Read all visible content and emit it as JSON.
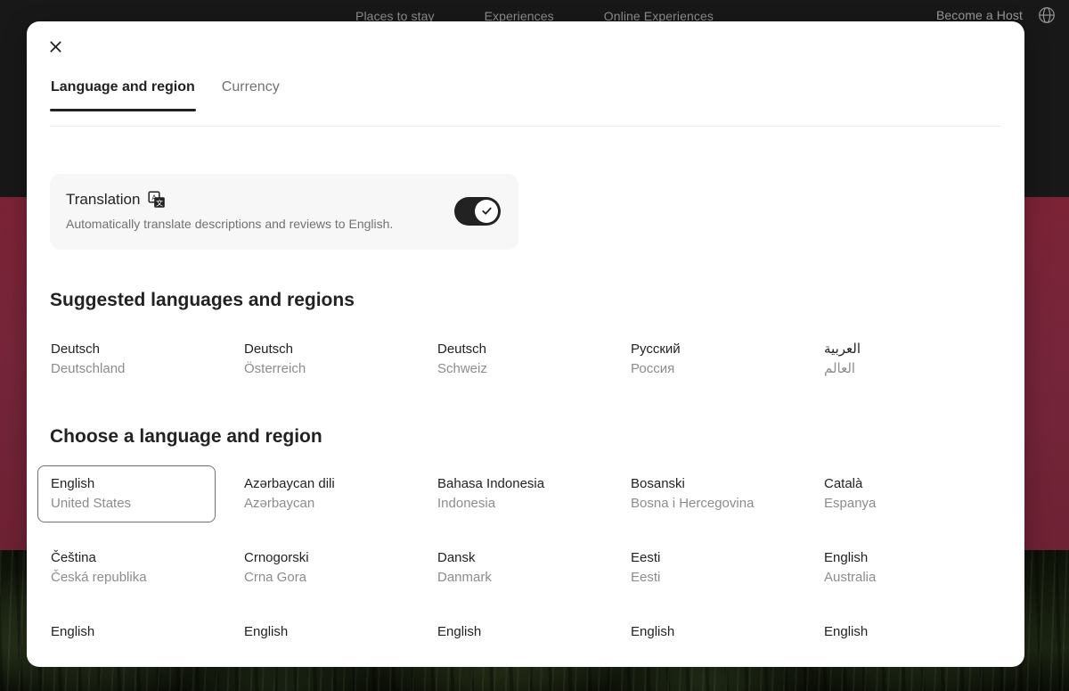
{
  "site": {
    "nav_links": [
      "Places to stay",
      "Experiences",
      "Online Experiences"
    ],
    "become_host": "Become a Host",
    "globe_icon": "globe-icon",
    "header_bg": "#181818",
    "hero_band_color": "#7c2336"
  },
  "modal": {
    "close_icon": "close-icon",
    "tabs": [
      {
        "label": "Language and region",
        "active": true
      },
      {
        "label": "Currency",
        "active": false
      }
    ],
    "translation": {
      "title": "Translation",
      "icon": "translate-icon",
      "description": "Automatically translate descriptions and reviews to English.",
      "enabled": true,
      "toggle_icon": "check-icon",
      "toggle_on_color": "#222222"
    },
    "suggested": {
      "heading": "Suggested languages and regions",
      "items": [
        {
          "name": "Deutsch",
          "region": "Deutschland",
          "rtl": false
        },
        {
          "name": "Deutsch",
          "region": "Österreich",
          "rtl": false
        },
        {
          "name": "Deutsch",
          "region": "Schweiz",
          "rtl": false
        },
        {
          "name": "Русский",
          "region": "Россия",
          "rtl": false
        },
        {
          "name": "العربية",
          "region": "العالم",
          "rtl": true
        }
      ]
    },
    "choose": {
      "heading": "Choose a language and region",
      "items": [
        {
          "name": "English",
          "region": "United States",
          "selected": true
        },
        {
          "name": "Azərbaycan dili",
          "region": "Azərbaycan",
          "selected": false
        },
        {
          "name": "Bahasa Indonesia",
          "region": "Indonesia",
          "selected": false
        },
        {
          "name": "Bosanski",
          "region": "Bosna i Hercegovina",
          "selected": false
        },
        {
          "name": "Català",
          "region": "Espanya",
          "selected": false
        },
        {
          "name": "Čeština",
          "region": "Česká republika",
          "selected": false
        },
        {
          "name": "Crnogorski",
          "region": "Crna Gora",
          "selected": false
        },
        {
          "name": "Dansk",
          "region": "Danmark",
          "selected": false
        },
        {
          "name": "Eesti",
          "region": "Eesti",
          "selected": false
        },
        {
          "name": "English",
          "region": "Australia",
          "selected": false
        },
        {
          "name": "English",
          "region": "",
          "selected": false
        },
        {
          "name": "English",
          "region": "",
          "selected": false
        },
        {
          "name": "English",
          "region": "",
          "selected": false
        },
        {
          "name": "English",
          "region": "",
          "selected": false
        },
        {
          "name": "English",
          "region": "",
          "selected": false
        }
      ]
    }
  }
}
